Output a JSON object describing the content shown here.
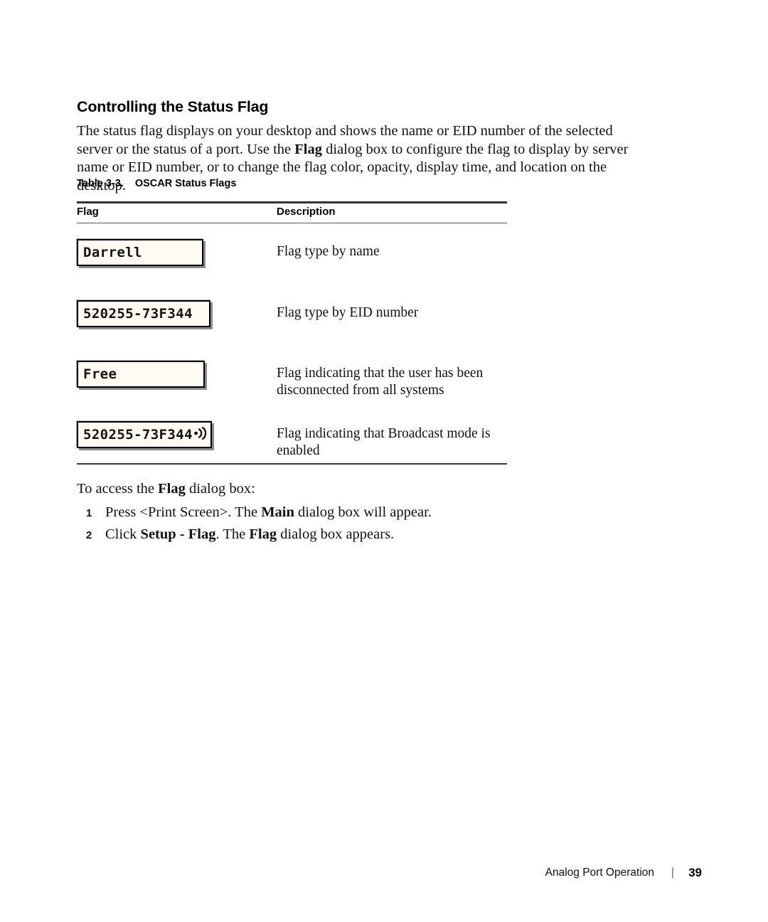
{
  "section": {
    "heading": "Controlling the Status Flag",
    "intro_part1": "The status flag displays on your desktop and shows the name or EID number of the selected server or the status of a port. Use the ",
    "intro_bold1": "Flag",
    "intro_part2": " dialog box to configure the flag to display by server name or EID number, or to change the flag color, opacity, display time, and location on the desktop."
  },
  "table": {
    "caption_number": "Table 3-3.",
    "caption_title": "OSCAR Status Flags",
    "columns": [
      "Flag",
      "Description"
    ],
    "rows": [
      {
        "flag_text": "Darrell",
        "flag_kind": "name",
        "has_broadcast_icon": false,
        "description": "Flag type by name"
      },
      {
        "flag_text": "520255-73F344",
        "flag_kind": "eid",
        "has_broadcast_icon": false,
        "description": "Flag type by EID number"
      },
      {
        "flag_text": "Free",
        "flag_kind": "free",
        "has_broadcast_icon": false,
        "description": "Flag indicating that the user has been disconnected from all systems"
      },
      {
        "flag_text": "520255-73F344",
        "flag_kind": "broadcast",
        "has_broadcast_icon": true,
        "icon_name": "broadcast-speaker-icon",
        "description": "Flag indicating that Broadcast mode is enabled"
      }
    ]
  },
  "instructions": {
    "lead_part1": "To access the ",
    "lead_bold": "Flag",
    "lead_part2": " dialog box:",
    "steps": [
      {
        "number": "1",
        "part1": "Press <Print Screen>. The ",
        "bold": "Main",
        "part2": " dialog box will appear."
      },
      {
        "number": "2",
        "part1": "Click ",
        "bold": "Setup - Flag",
        "part2": ". The ",
        "bold2": "Flag",
        "part3": " dialog box appears."
      }
    ]
  },
  "footer": {
    "label": "Analog Port Operation",
    "separator": "|",
    "page_number": "39"
  },
  "colors": {
    "flag_fill": "#fdfbf2",
    "flag_border": "#000000",
    "flag_shadow": "#8a8a8a",
    "rule": "#333333"
  }
}
